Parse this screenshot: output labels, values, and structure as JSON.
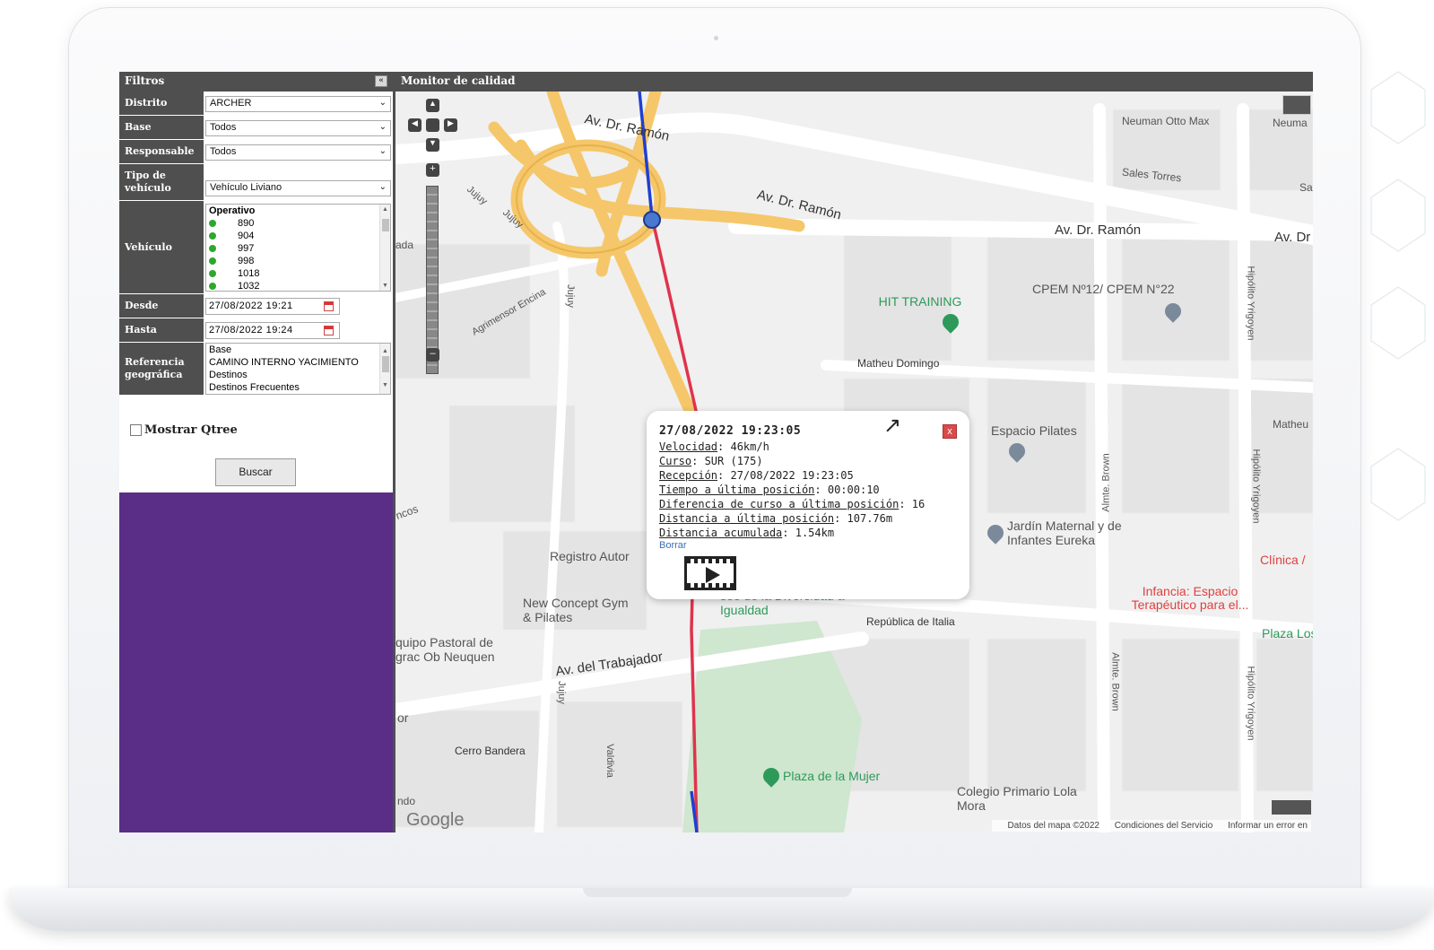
{
  "filters": {
    "title": "Filtros",
    "collapse_icon": "«",
    "distrito": {
      "label": "Distrito",
      "value": "ARCHER"
    },
    "base": {
      "label": "Base",
      "value": "Todos"
    },
    "responsable": {
      "label": "Responsable",
      "value": "Todos"
    },
    "tipo_vehiculo": {
      "label": "Tipo de vehículo",
      "value": "Vehículo Liviano"
    },
    "vehiculo": {
      "label": "Vehículo",
      "group": "Operativo",
      "status_color": "#2ca82c",
      "items": [
        "890",
        "904",
        "997",
        "998",
        "1018",
        "1032"
      ]
    },
    "desde": {
      "label": "Desde",
      "value": "27/08/2022 19:21"
    },
    "hasta": {
      "label": "Hasta",
      "value": "27/08/2022 19:24"
    },
    "referencia": {
      "label": "Referencia geográfica",
      "items": [
        "Base",
        "CAMINO INTERNO YACIMIENTO",
        "Destinos",
        "Destinos Frecuentes"
      ]
    },
    "mostrar_qtree": "Mostrar Qtree",
    "buscar": "Buscar"
  },
  "map": {
    "title": "Monitor de calidad",
    "streets": [
      "Av. Dr. Ramón",
      "Av. Dr. Ramón",
      "Av. Dr. Ramón",
      "Av. Dr",
      "Jujuy",
      "Jujuy",
      "Jujuy",
      "Jujuy",
      "Agrimensor Encina",
      "Neuman Otto Max",
      "Neuma",
      "Sales Torres",
      "Sa",
      "Matheu Domingo",
      "Matheu",
      "Hipólito Yrigoyen",
      "Hipólito Yrigoyen",
      "Hipólito Yrigoyen",
      "Almte. Brown",
      "Almte. Brown",
      "República de Italia",
      "Av. del Trabajador",
      "Cerro Bandera",
      "Valdivia",
      "ada",
      "ncos",
      "or",
      "ndo"
    ],
    "pois": [
      "HIT TRAINING",
      "CPEM Nº12/ CPEM N°22",
      "Espacio Pilates",
      "Jardín Maternal y de Infantes Eureka",
      "Clínica /",
      "Infancia: Espacio Terapéutico para el...",
      "Plaza Los",
      "Registro Autor",
      "New Concept Gym & Pilates",
      "quipo Pastoral de grac Ob Neuquen",
      "seo de la Diversidad a Igualdad",
      "Plaza de la Mujer",
      "Colegio Primario Lola Mora"
    ],
    "google_logo": "Google",
    "footer": [
      "Datos del mapa ©2022",
      "Condiciones del Servicio",
      "Informar un error en"
    ],
    "route_colors": {
      "blue": "#1f3fd1",
      "red": "#e0334c"
    },
    "popup": {
      "title": "27/08/2022 19:23:05",
      "velocidad_label": "Velocidad",
      "velocidad": "46km/h",
      "curso_label": "Curso",
      "curso": "SUR (175)",
      "recepcion_label": "Recepción",
      "recepcion": "27/08/2022 19:23:05",
      "tiempo_label": "Tiempo a última posición",
      "tiempo": "00:00:10",
      "diferencia_label": "Diferencia de curso a última posición",
      "diferencia": "16",
      "distancia_label": "Distancia a última posición",
      "distancia": "107.76m",
      "acumulada_label": "Distancia acumulada",
      "acumulada": "1.54km",
      "borrar": "Borrar",
      "close_icon": "x",
      "play_icon": "film-play-icon"
    }
  }
}
